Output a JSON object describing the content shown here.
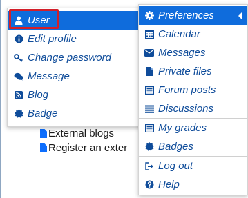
{
  "tree": {
    "items": [
      {
        "label": "External blogs"
      },
      {
        "label": "Register an exter"
      }
    ]
  },
  "user_menu": {
    "items": [
      {
        "label": "User",
        "icon": "user-icon"
      },
      {
        "label": "Edit profile",
        "icon": "info-circle-icon"
      },
      {
        "label": "Change password",
        "icon": "key-icon"
      },
      {
        "label": "Message",
        "icon": "chat-bubbles-icon"
      },
      {
        "label": "Blog",
        "icon": "rss-icon"
      },
      {
        "label": "Badge",
        "icon": "badge-icon"
      }
    ]
  },
  "preferences_menu": {
    "items": [
      {
        "label": "Preferences",
        "icon": "gear-icon"
      },
      {
        "label": "Calendar",
        "icon": "calendar-icon"
      },
      {
        "label": "Messages",
        "icon": "envelope-icon"
      },
      {
        "label": "Private files",
        "icon": "file-icon"
      },
      {
        "label": "Forum posts",
        "icon": "list-alt-icon"
      },
      {
        "label": "Discussions",
        "icon": "list-icon"
      },
      {
        "label": "My grades",
        "icon": "list-alt-icon"
      },
      {
        "label": "Badges",
        "icon": "badge-icon"
      },
      {
        "label": "Log out",
        "icon": "sign-out-icon"
      },
      {
        "label": "Help",
        "icon": "question-circle-icon"
      }
    ]
  },
  "colors": {
    "accent": "#0f6cdc",
    "link": "#0f4c9a",
    "highlight": "#d21f2a"
  }
}
